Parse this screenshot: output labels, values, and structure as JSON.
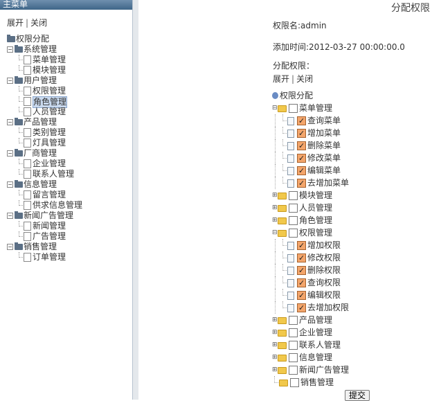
{
  "left": {
    "header": "主菜单",
    "expand": "展开",
    "divider": "|",
    "collapse": "关闭",
    "root": "权限分配",
    "groups": [
      {
        "label": "系统管理",
        "items": [
          "菜单管理",
          "模块管理"
        ]
      },
      {
        "label": "用户管理",
        "items": [
          "权限管理",
          "角色管理",
          "人员管理"
        ]
      },
      {
        "label": "产品管理",
        "items": [
          "类别管理",
          "灯具管理"
        ]
      },
      {
        "label": "厂商管理",
        "items": [
          "企业管理",
          "联系人管理"
        ]
      },
      {
        "label": "信息管理",
        "items": [
          "留言管理",
          "供求信息管理"
        ]
      },
      {
        "label": "新闻广告管理",
        "items": [
          "新闻管理",
          "广告管理"
        ]
      },
      {
        "label": "销售管理",
        "items": [
          "订单管理"
        ]
      }
    ],
    "selected": "角色管理"
  },
  "right": {
    "title": "分配权限",
    "role_name_label": "权限名:",
    "role_name": "admin",
    "added_label": "添加时间:",
    "added_time": "2012-03-27 00:00:00.0",
    "assign_label": "分配权限：",
    "expand": "展开",
    "divider": "|",
    "collapse": "关闭",
    "root": "权限分配",
    "nodes": [
      {
        "label": "菜单管理",
        "open": true,
        "checked": false,
        "children": [
          {
            "label": "查询菜单",
            "checked": true
          },
          {
            "label": "增加菜单",
            "checked": true
          },
          {
            "label": "删除菜单",
            "checked": true
          },
          {
            "label": "修改菜单",
            "checked": true
          },
          {
            "label": "编辑菜单",
            "checked": true
          },
          {
            "label": "去增加菜单",
            "checked": true
          }
        ]
      },
      {
        "label": "模块管理",
        "open": false,
        "checked": false
      },
      {
        "label": "人员管理",
        "open": false,
        "checked": false
      },
      {
        "label": "角色管理",
        "open": false,
        "checked": false
      },
      {
        "label": "权限管理",
        "open": true,
        "checked": false,
        "children": [
          {
            "label": "增加权限",
            "checked": true
          },
          {
            "label": "修改权限",
            "checked": true
          },
          {
            "label": "删除权限",
            "checked": true
          },
          {
            "label": "查询权限",
            "checked": true
          },
          {
            "label": "编辑权限",
            "checked": true
          },
          {
            "label": "去增加权限",
            "checked": true
          }
        ]
      },
      {
        "label": "产品管理",
        "open": false,
        "checked": false
      },
      {
        "label": "企业管理",
        "open": false,
        "checked": false
      },
      {
        "label": "联系人管理",
        "open": false,
        "checked": false
      },
      {
        "label": "信息管理",
        "open": false,
        "checked": false
      },
      {
        "label": "新闻广告管理",
        "open": false,
        "checked": false
      },
      {
        "label": "销售管理",
        "open": false,
        "checked": false,
        "last": true
      }
    ],
    "submit": "提交"
  }
}
